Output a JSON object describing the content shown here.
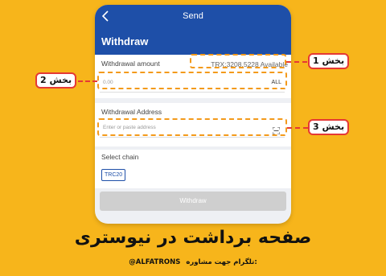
{
  "app": {
    "nav_title": "Send",
    "heading": "Withdraw"
  },
  "amount": {
    "label": "Withdrawal amount",
    "available": "TRX:3208.5228 Available",
    "placeholder": "0.00",
    "all_label": "ALL"
  },
  "address": {
    "label": "Withdrawal Address",
    "placeholder": "Enter or paste address"
  },
  "chain": {
    "label": "Select chain",
    "selected": "TRC20"
  },
  "actions": {
    "withdraw_label": "Withdraw"
  },
  "annotations": {
    "tag1": "بخش 1",
    "tag2": "بخش 2",
    "tag3": "بخش 3"
  },
  "footer": {
    "title": "صفحه برداشت در نیوستری",
    "contact_text": "تلگرام جهت مشاوره:",
    "handle": "@ALFATRONS"
  },
  "colors": {
    "background": "#F7B51B",
    "brand_blue": "#1E4FA8",
    "annotation_red": "#E53935",
    "highlight_orange": "#F39A1B"
  },
  "icons": {
    "back": "chevron-left-icon",
    "scan": "scan-icon"
  }
}
